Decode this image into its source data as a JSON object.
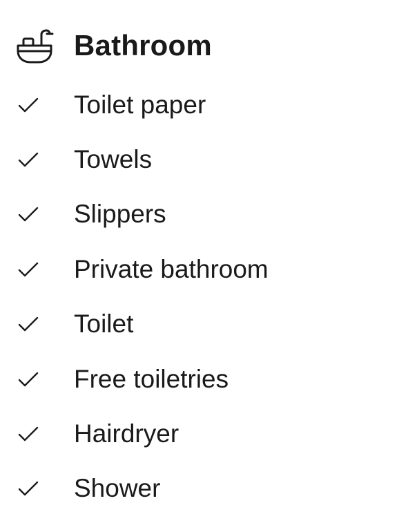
{
  "section": {
    "title": "Bathroom",
    "icon": "bath-icon",
    "items": [
      {
        "label": "Toilet paper",
        "icon": "checkmark-icon"
      },
      {
        "label": "Towels",
        "icon": "checkmark-icon"
      },
      {
        "label": "Slippers",
        "icon": "checkmark-icon"
      },
      {
        "label": "Private bathroom",
        "icon": "checkmark-icon"
      },
      {
        "label": "Toilet",
        "icon": "checkmark-icon"
      },
      {
        "label": "Free toiletries",
        "icon": "checkmark-icon"
      },
      {
        "label": "Hairdryer",
        "icon": "checkmark-icon"
      },
      {
        "label": "Shower",
        "icon": "checkmark-icon"
      }
    ]
  },
  "colors": {
    "text": "#1a1a1a",
    "background": "#ffffff"
  }
}
